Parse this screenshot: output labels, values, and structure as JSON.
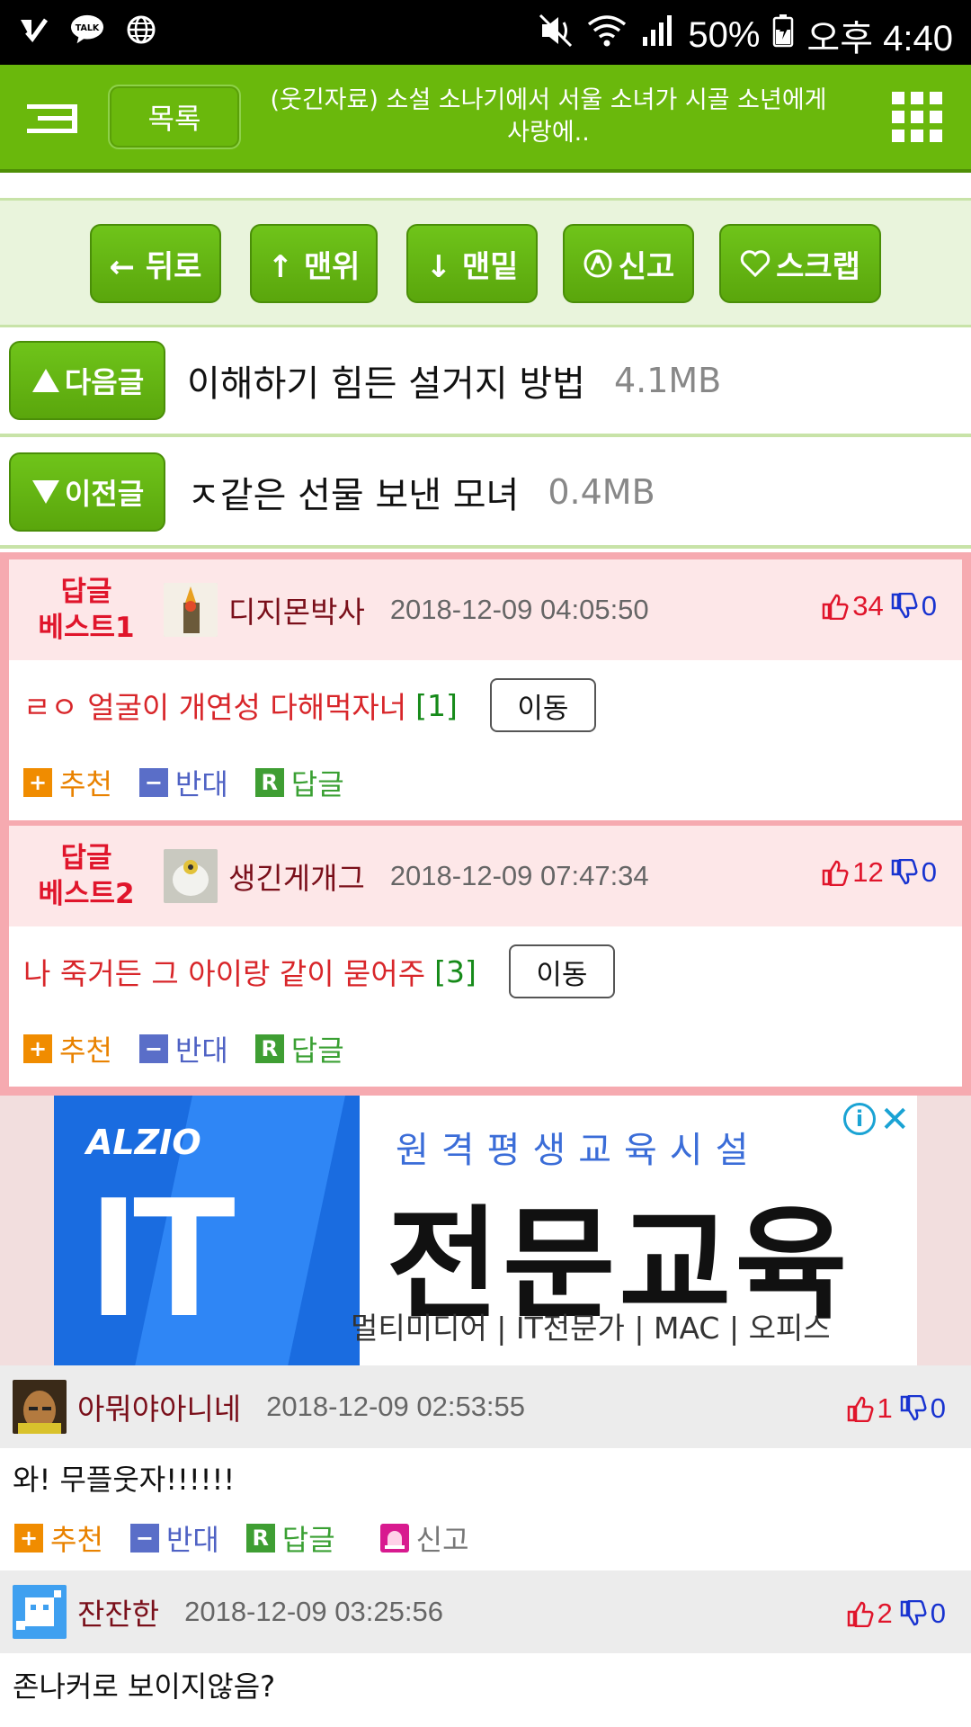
{
  "status_bar": {
    "icons_left": [
      "check-icon",
      "kakaotalk-icon",
      "globe-icon"
    ],
    "talk_label": "TALK",
    "battery": "50%",
    "time": "오후 4:40"
  },
  "header": {
    "list_label": "목록",
    "title": "(웃긴자료) 소설 소나기에서 서울 소녀가 시골 소년에게 사랑에.."
  },
  "toolbar": {
    "back": "← 뒤로",
    "top": "↑ 맨위",
    "bottom": "↓ 맨밑",
    "report": "신고",
    "scrap": "스크랩"
  },
  "next_post": {
    "label": "다음글",
    "title": "이해하기 힘든 설거지 방법",
    "size": "4.1MB"
  },
  "prev_post": {
    "label": "이전글",
    "title": "ㅈ같은 선물 보낸 모녀",
    "size": "0.4MB"
  },
  "best_replies": [
    {
      "rank_line1": "답글",
      "rank_line2": "베스트1",
      "nick": "디지몬박사",
      "date": "2018-12-09 04:05:50",
      "up": "34",
      "down": "0",
      "text": "ㄹㅇ 얼굴이 개연성 다해먹자너",
      "replies": "[1]",
      "move": "이동"
    },
    {
      "rank_line1": "답글",
      "rank_line2": "베스트2",
      "nick": "생긴게개그",
      "date": "2018-12-09 07:47:34",
      "up": "12",
      "down": "0",
      "text": "나 죽거든 그 아이랑 같이 묻어주",
      "replies": "[3]",
      "move": "이동"
    }
  ],
  "actions": {
    "recommend": "추천",
    "oppose": "반대",
    "reply": "답글",
    "report": "신고",
    "rec_mark": "+",
    "opp_mark": "−",
    "rep_mark": "R"
  },
  "ad": {
    "brand": "ALZIO",
    "big": "IT",
    "sub": "원격평생교육시설",
    "main": "전문교육",
    "foot": "멀티미디어 | IT전문가 | MAC | 오피스",
    "info": "i",
    "close": "✕"
  },
  "comments": [
    {
      "nick": "아뭐야아니네",
      "date": "2018-12-09 02:53:55",
      "up": "1",
      "down": "0",
      "text": "와! 무플웃자!!!!!!"
    },
    {
      "nick": "잔잔한",
      "date": "2018-12-09 03:25:56",
      "up": "2",
      "down": "0",
      "text": "존나커로 보이지않음?"
    }
  ],
  "colors": {
    "header_green": "#6ab80c",
    "best_border": "#f6aab0",
    "up_red": "#e0152b",
    "down_blue": "#1833d0"
  }
}
